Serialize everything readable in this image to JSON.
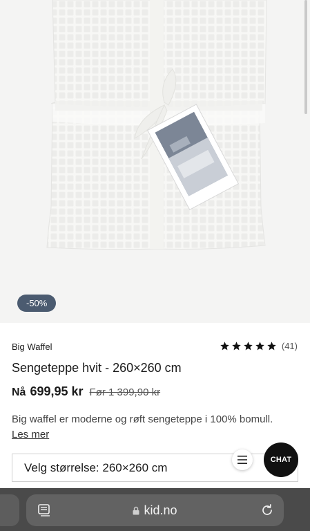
{
  "product": {
    "badge": "-50%",
    "brand": "Big Waffel",
    "rating_stars": 5,
    "rating_count": "(41)",
    "title": "Sengeteppe hvit - 260×260 cm",
    "price_prefix": "Nå",
    "price_current": "699,95 kr",
    "price_old": "Før 1 399,90 kr",
    "description": "Big waffel er moderne og røft sengeteppe i 100% bomull.",
    "read_more": "Les mer",
    "size_select": "Velg størrelse: 260×260 cm"
  },
  "widgets": {
    "chat_label": "CHAT"
  },
  "browser": {
    "url": "kid.no"
  },
  "colors": {
    "badge_bg": "#4b5b70",
    "chat_bg": "#111111",
    "browser_bar": "#4a4a4a",
    "image_bg": "#f4f4f3"
  },
  "icons": [
    "star-icon",
    "menu-icon",
    "tabs-icon",
    "lock-icon",
    "reload-icon"
  ]
}
